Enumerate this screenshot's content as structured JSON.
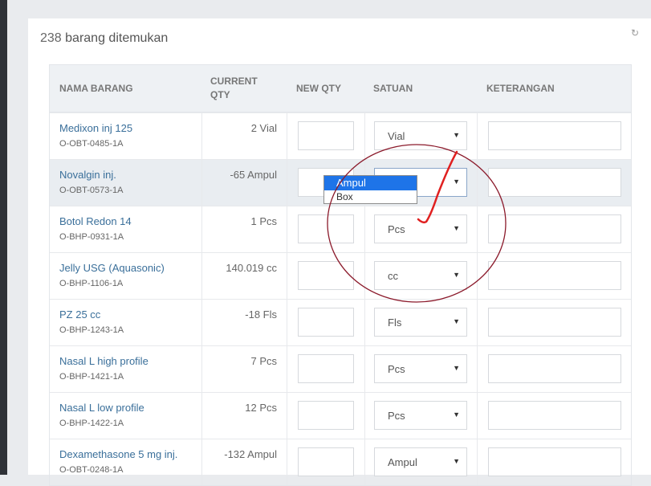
{
  "header": {
    "count": "238",
    "title_rest": "barang ditemukan"
  },
  "columns": {
    "name": "NAMA BARANG",
    "current_qty": "CURRENT QTY",
    "new_qty": "NEW QTY",
    "satuan": "SATUAN",
    "keterangan": "KETERANGAN"
  },
  "rows": [
    {
      "name": "Medixon inj 125",
      "code": "O-OBT-0485-1A",
      "qty": "2 Vial",
      "unit": "Vial"
    },
    {
      "name": "Novalgin inj.",
      "code": "O-OBT-0573-1A",
      "qty": "-65 Ampul",
      "unit": "Ampul"
    },
    {
      "name": "Botol Redon 14",
      "code": "O-BHP-0931-1A",
      "qty": "1 Pcs",
      "unit": "Pcs"
    },
    {
      "name": "Jelly USG (Aquasonic)",
      "code": "O-BHP-1106-1A",
      "qty": "140.019 cc",
      "unit": "cc"
    },
    {
      "name": "PZ 25 cc",
      "code": "O-BHP-1243-1A",
      "qty": "-18 Fls",
      "unit": "Fls"
    },
    {
      "name": "Nasal L high profile",
      "code": "O-BHP-1421-1A",
      "qty": "7 Pcs",
      "unit": "Pcs"
    },
    {
      "name": "Nasal L low profile",
      "code": "O-BHP-1422-1A",
      "qty": "12 Pcs",
      "unit": "Pcs"
    },
    {
      "name": "Dexamethasone 5 mg inj.",
      "code": "O-OBT-0248-1A",
      "qty": "-132 Ampul",
      "unit": "Ampul"
    }
  ],
  "dropdown": {
    "options": [
      "Ampul",
      "Box"
    ],
    "selected": "Ampul"
  },
  "icons": {
    "refresh": "refresh-icon",
    "caret": "chevron-down-icon"
  },
  "colors": {
    "link": "#3a6f9a",
    "header_bg": "#eef1f4",
    "highlight_row": "#e9edf1",
    "dropdown_selected": "#1e74e8",
    "annotation": "#8b1a2b",
    "annotation_check": "#e02020"
  }
}
